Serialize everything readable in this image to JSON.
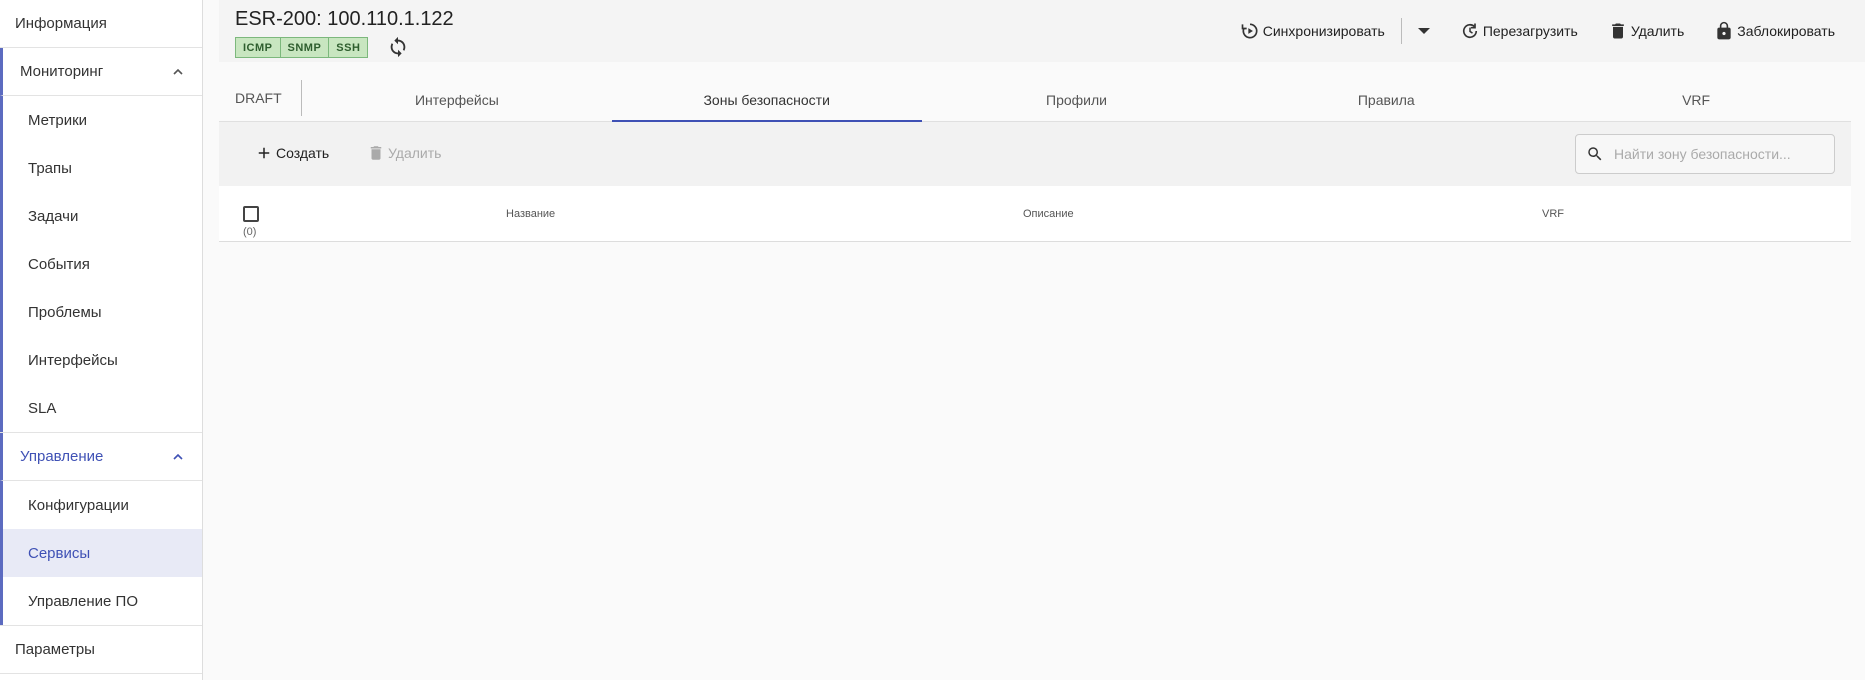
{
  "sidebar": {
    "info": "Информация",
    "monitoring": {
      "label": "Мониторинг",
      "items": [
        "Метрики",
        "Трапы",
        "Задачи",
        "События",
        "Проблемы",
        "Интерфейсы",
        "SLA"
      ]
    },
    "management": {
      "label": "Управление",
      "items": [
        "Конфигурации",
        "Сервисы",
        "Управление ПО"
      ],
      "selected": "Сервисы"
    },
    "params": "Параметры"
  },
  "header": {
    "title": "ESR-200: 100.110.1.122",
    "badges": [
      "ICMP",
      "SNMP",
      "SSH"
    ],
    "actions": {
      "sync": "Синхронизировать",
      "reboot": "Перезагрузить",
      "delete": "Удалить",
      "lock": "Заблокировать"
    }
  },
  "tabs": {
    "draft": "DRAFT",
    "items": [
      "Интерфейсы",
      "Зоны безопасности",
      "Профили",
      "Правила",
      "VRF"
    ],
    "active": "Зоны безопасности"
  },
  "toolbar": {
    "create": "Создать",
    "delete": "Удалить",
    "search_placeholder": "Найти зону безопасности..."
  },
  "table": {
    "count": "(0)",
    "columns": [
      "Название",
      "Описание",
      "VRF"
    ]
  },
  "colors": {
    "accent": "#3f51b5",
    "badge_bg": "#c8e6c0",
    "selected_bg": "#e8eaf6"
  }
}
